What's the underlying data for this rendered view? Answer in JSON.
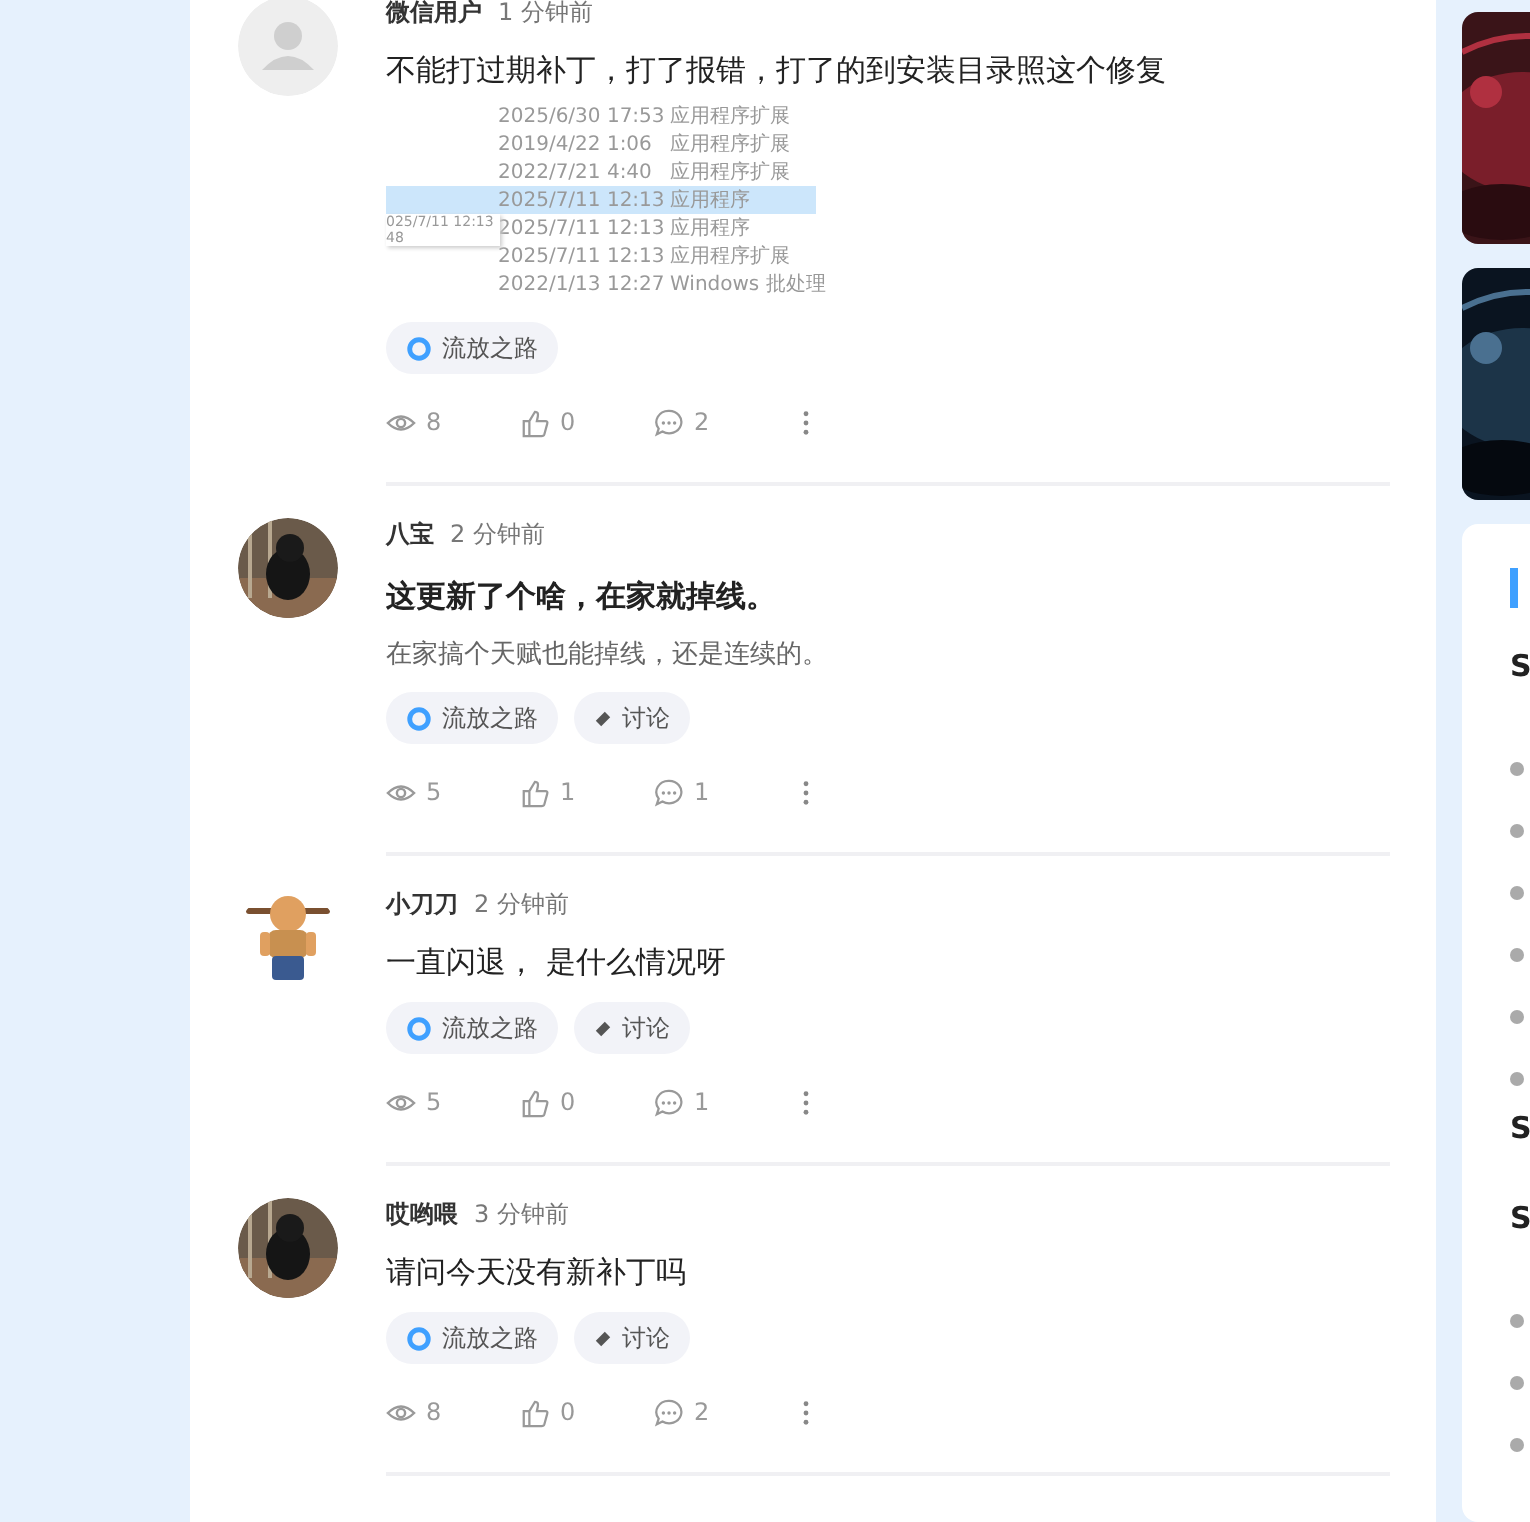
{
  "posts": [
    {
      "author": "微信用户",
      "time": "1 分钟前",
      "avatar": {
        "kind": "default"
      },
      "body": "不能打过期补丁，打了报错，打了的到安装目录照这个修复",
      "screenshot": {
        "tooltip": [
          "025/7/11 12:13",
          "48"
        ],
        "rows": [
          {
            "date": "2025/6/30 17:53",
            "type": "应用程序扩展",
            "selected": false
          },
          {
            "date": "2019/4/22 1:06",
            "type": "应用程序扩展",
            "selected": false
          },
          {
            "date": "2022/7/21 4:40",
            "type": "应用程序扩展",
            "selected": false
          },
          {
            "date": "2025/7/11 12:13",
            "type": "应用程序",
            "selected": true
          },
          {
            "date": "2025/7/11 12:13",
            "type": "应用程序",
            "selected": false
          },
          {
            "date": "2025/7/11 12:13",
            "type": "应用程序扩展",
            "selected": false
          },
          {
            "date": "2022/1/13 12:27",
            "type": "Windows 批处理",
            "selected": false
          }
        ]
      },
      "tags": [
        {
          "kind": "game",
          "label": "流放之路"
        }
      ],
      "views": "8",
      "likes": "0",
      "comments": "2"
    },
    {
      "author": "八宝",
      "time": "2 分钟前",
      "title": "这更新了个啥，在家就掉线。",
      "body": "在家搞个天赋也能掉线，还是连续的。",
      "tags": [
        {
          "kind": "game",
          "label": "流放之路"
        },
        {
          "kind": "discussion",
          "label": "讨论"
        }
      ],
      "views": "5",
      "likes": "1",
      "comments": "1"
    },
    {
      "author": "小刀刀",
      "time": "2 分钟前",
      "avatar": {
        "kind": "figure"
      },
      "body": "一直闪退， 是什么情况呀",
      "tags": [
        {
          "kind": "game",
          "label": "流放之路"
        },
        {
          "kind": "discussion",
          "label": "讨论"
        }
      ],
      "views": "5",
      "likes": "0",
      "comments": "1"
    },
    {
      "author": "哎哟喂",
      "time": "3 分钟前",
      "body": "请问今天没有新补丁吗",
      "tags": [
        {
          "kind": "game",
          "label": "流放之路"
        },
        {
          "kind": "discussion",
          "label": "讨论"
        }
      ],
      "views": "8",
      "likes": "0",
      "comments": "2"
    }
  ],
  "sidebar": {
    "panel": {
      "items": [
        {
          "kind": "heading",
          "text": "S"
        },
        {
          "kind": "bullet"
        },
        {
          "kind": "bullet"
        },
        {
          "kind": "bullet"
        },
        {
          "kind": "bullet"
        },
        {
          "kind": "bullet"
        },
        {
          "kind": "bullet"
        },
        {
          "kind": "heading",
          "text": "S"
        },
        {
          "kind": "heading",
          "text": "S"
        },
        {
          "kind": "bullet"
        },
        {
          "kind": "bullet"
        },
        {
          "kind": "bullet"
        }
      ]
    }
  }
}
